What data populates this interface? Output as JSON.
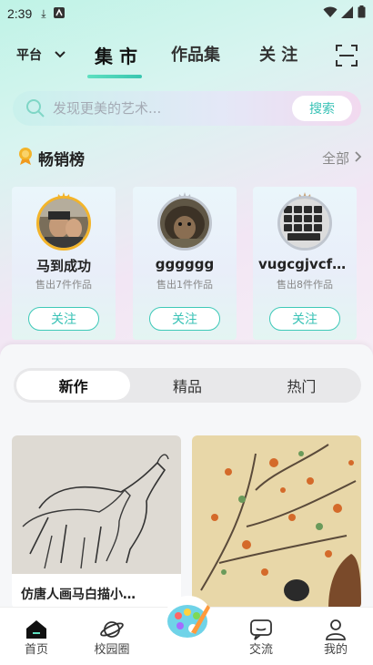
{
  "status_bar": {
    "time": "2:39"
  },
  "top_nav": {
    "platform_label": "平台",
    "tabs": [
      {
        "label": "集 市",
        "active": true
      },
      {
        "label": "作品集",
        "active": false
      },
      {
        "label": "关 注",
        "active": false
      }
    ]
  },
  "search": {
    "placeholder": "发现更美的艺术...",
    "button_label": "搜索"
  },
  "bestseller": {
    "title": "畅销榜",
    "all_label": "全部",
    "artists": [
      {
        "rank": "1",
        "name": "马到成功",
        "sold": "售出7件作品",
        "follow_label": "关注"
      },
      {
        "rank": "2",
        "name": "gggggg",
        "sold": "售出1件作品",
        "follow_label": "关注"
      },
      {
        "rank": "3",
        "name": "vugcgjvcfb...",
        "sold": "售出8件作品",
        "follow_label": "关注"
      }
    ]
  },
  "segments": [
    {
      "label": "新作",
      "active": true
    },
    {
      "label": "精品",
      "active": false
    },
    {
      "label": "热门",
      "active": false
    }
  ],
  "artworks": [
    {
      "caption": "仿唐人画马白描小…"
    },
    {
      "caption": ""
    }
  ],
  "bottom_nav": [
    {
      "label": "首页",
      "active": true
    },
    {
      "label": "校园圈",
      "active": false
    },
    {
      "label": "交流",
      "active": false
    },
    {
      "label": "我的",
      "active": false
    }
  ],
  "colors": {
    "accent": "#38c2b6",
    "gold": "#f3b42a"
  }
}
